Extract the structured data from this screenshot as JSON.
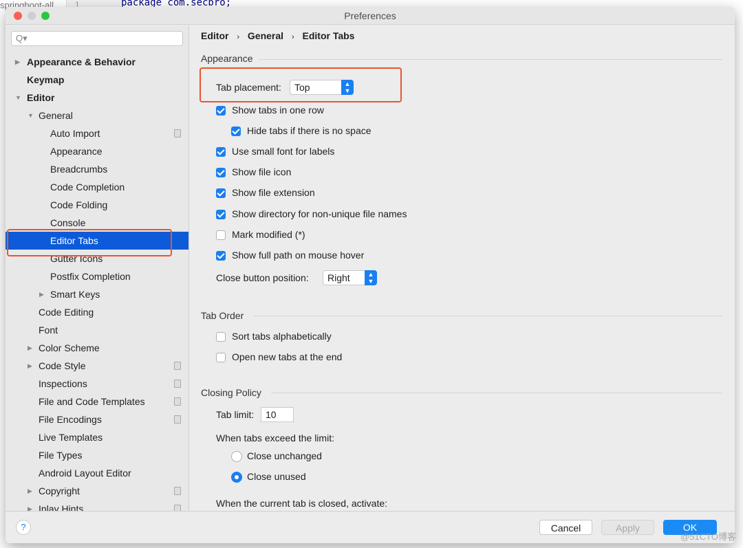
{
  "background": {
    "project_tab": "springboot-all",
    "line_number": "1",
    "code": "package com.secbro;"
  },
  "window": {
    "title": "Preferences"
  },
  "sidebar": {
    "search_placeholder": "Q▾",
    "items": [
      {
        "label": "Appearance & Behavior",
        "level": 0,
        "arrow": "right",
        "bold": true
      },
      {
        "label": "Keymap",
        "level": 0,
        "bold": true
      },
      {
        "label": "Editor",
        "level": 0,
        "arrow": "down",
        "bold": true
      },
      {
        "label": "General",
        "level": 1,
        "arrow": "down"
      },
      {
        "label": "Auto Import",
        "level": 2,
        "copy": true
      },
      {
        "label": "Appearance",
        "level": 2
      },
      {
        "label": "Breadcrumbs",
        "level": 2
      },
      {
        "label": "Code Completion",
        "level": 2
      },
      {
        "label": "Code Folding",
        "level": 2
      },
      {
        "label": "Console",
        "level": 2
      },
      {
        "label": "Editor Tabs",
        "level": 2,
        "selected": true
      },
      {
        "label": "Gutter Icons",
        "level": 2
      },
      {
        "label": "Postfix Completion",
        "level": 2
      },
      {
        "label": "Smart Keys",
        "level": 2,
        "arrow": "right"
      },
      {
        "label": "Code Editing",
        "level": 1
      },
      {
        "label": "Font",
        "level": 1
      },
      {
        "label": "Color Scheme",
        "level": 1,
        "arrow": "right"
      },
      {
        "label": "Code Style",
        "level": 1,
        "arrow": "right",
        "copy": true
      },
      {
        "label": "Inspections",
        "level": 1,
        "copy": true
      },
      {
        "label": "File and Code Templates",
        "level": 1,
        "copy": true
      },
      {
        "label": "File Encodings",
        "level": 1,
        "copy": true
      },
      {
        "label": "Live Templates",
        "level": 1
      },
      {
        "label": "File Types",
        "level": 1
      },
      {
        "label": "Android Layout Editor",
        "level": 1
      },
      {
        "label": "Copyright",
        "level": 1,
        "arrow": "right",
        "copy": true
      },
      {
        "label": "Inlay Hints",
        "level": 1,
        "arrow": "right",
        "copy": true
      }
    ]
  },
  "breadcrumb": [
    "Editor",
    "General",
    "Editor Tabs"
  ],
  "appearance": {
    "title": "Appearance",
    "tab_placement_label": "Tab placement:",
    "tab_placement_value": "Top",
    "checkboxes": [
      {
        "label": "Show tabs in one row",
        "checked": true
      },
      {
        "label": "Hide tabs if there is no space",
        "checked": true
      },
      {
        "label": "Use small font for labels",
        "checked": true
      },
      {
        "label": "Show file icon",
        "checked": true
      },
      {
        "label": "Show file extension",
        "checked": true
      },
      {
        "label": "Show directory for non-unique file names",
        "checked": true
      },
      {
        "label": "Mark modified (*)",
        "checked": false
      },
      {
        "label": "Show full path on mouse hover",
        "checked": true
      }
    ],
    "close_button_label": "Close button position:",
    "close_button_value": "Right"
  },
  "tab_order": {
    "title": "Tab Order",
    "checkboxes": [
      {
        "label": "Sort tabs alphabetically",
        "checked": false
      },
      {
        "label": "Open new tabs at the end",
        "checked": false
      }
    ]
  },
  "closing_policy": {
    "title": "Closing Policy",
    "tab_limit_label": "Tab limit:",
    "tab_limit_value": "10",
    "exceed_label": "When tabs exceed the limit:",
    "radios": [
      {
        "label": "Close unchanged",
        "checked": false
      },
      {
        "label": "Close unused",
        "checked": true
      }
    ],
    "activate_label": "When the current tab is closed, activate:"
  },
  "footer": {
    "help": "?",
    "cancel": "Cancel",
    "apply": "Apply",
    "ok": "OK"
  },
  "watermark": "@51CTO博客",
  "colors": {
    "accent": "#1a7ff0",
    "selection": "#0d5bd8",
    "highlight_box": "#e8552f"
  }
}
